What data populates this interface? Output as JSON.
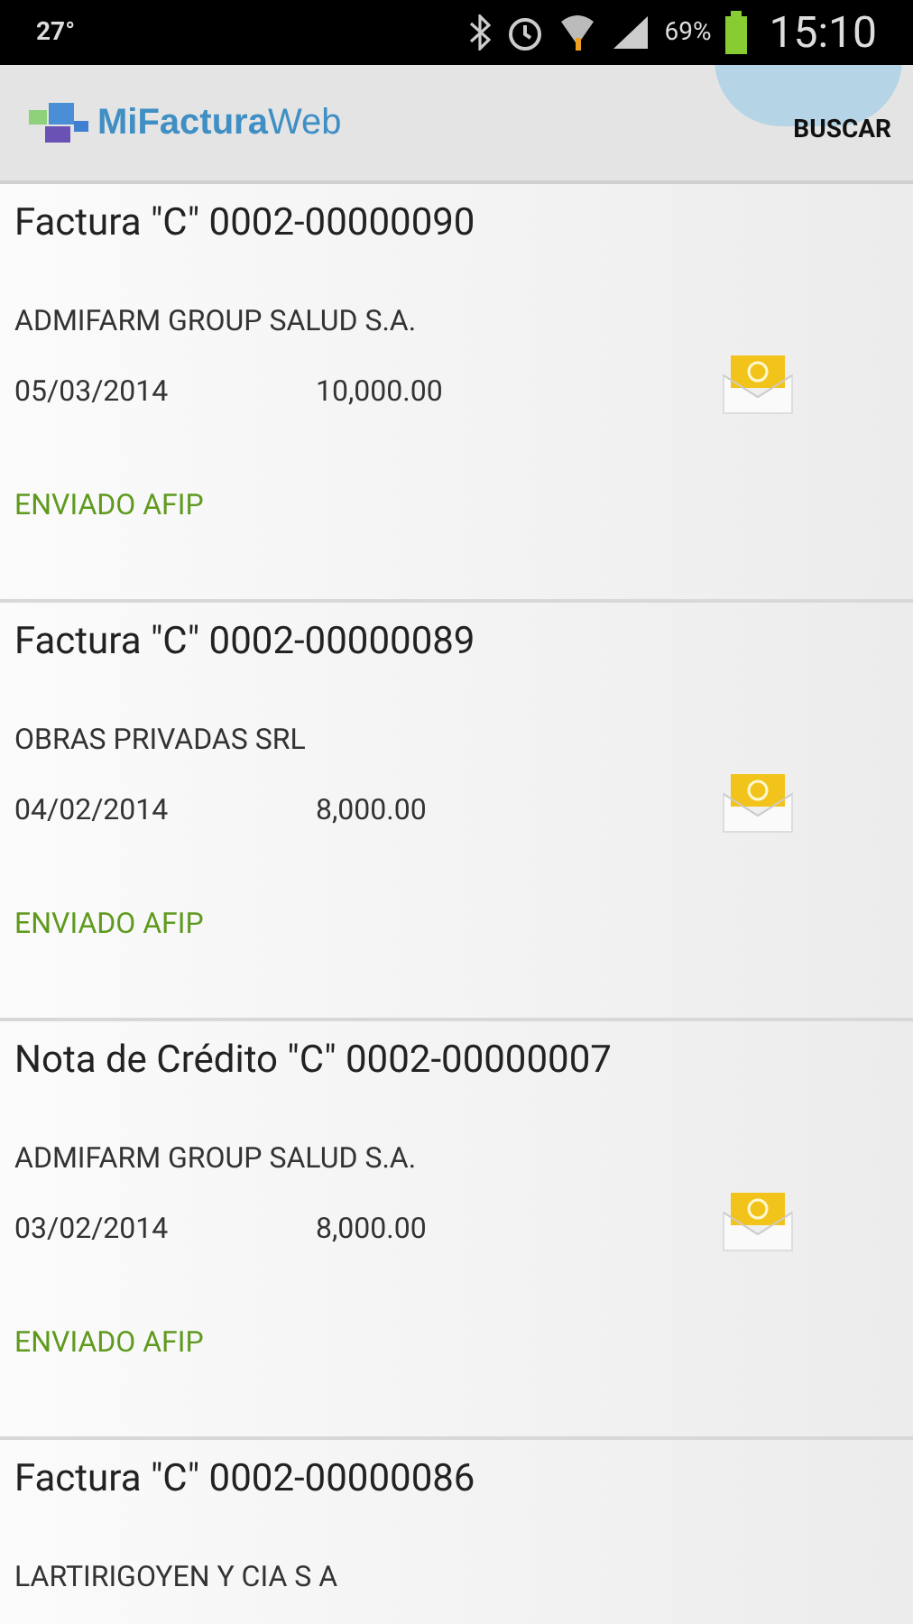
{
  "status_bar": {
    "temperature": "27°",
    "battery": "69%",
    "time": "15:10"
  },
  "app_bar": {
    "logo": "**MiFactura**Web",
    "action": "BUSCAR"
  },
  "invoices": [
    {
      "title": "Factura \"C\" 0002-00000090",
      "client": "ADMIFARM GROUP SALUD S.A.",
      "date": "05/03/2014",
      "amount": "10,000.00",
      "status": "ENVIADO AFIP"
    },
    {
      "title": "Factura \"C\" 0002-00000089",
      "client": "OBRAS PRIVADAS SRL",
      "date": "04/02/2014",
      "amount": "8,000.00",
      "status": "ENVIADO AFIP"
    },
    {
      "title": "Nota de Crédito \"C\" 0002-00000007",
      "client": "ADMIFARM GROUP SALUD S.A.",
      "date": "03/02/2014",
      "amount": "8,000.00",
      "status": "ENVIADO AFIP"
    },
    {
      "title": "Factura \"C\" 0002-00000086",
      "client": "LARTIRIGOYEN Y CIA S A"
    }
  ]
}
